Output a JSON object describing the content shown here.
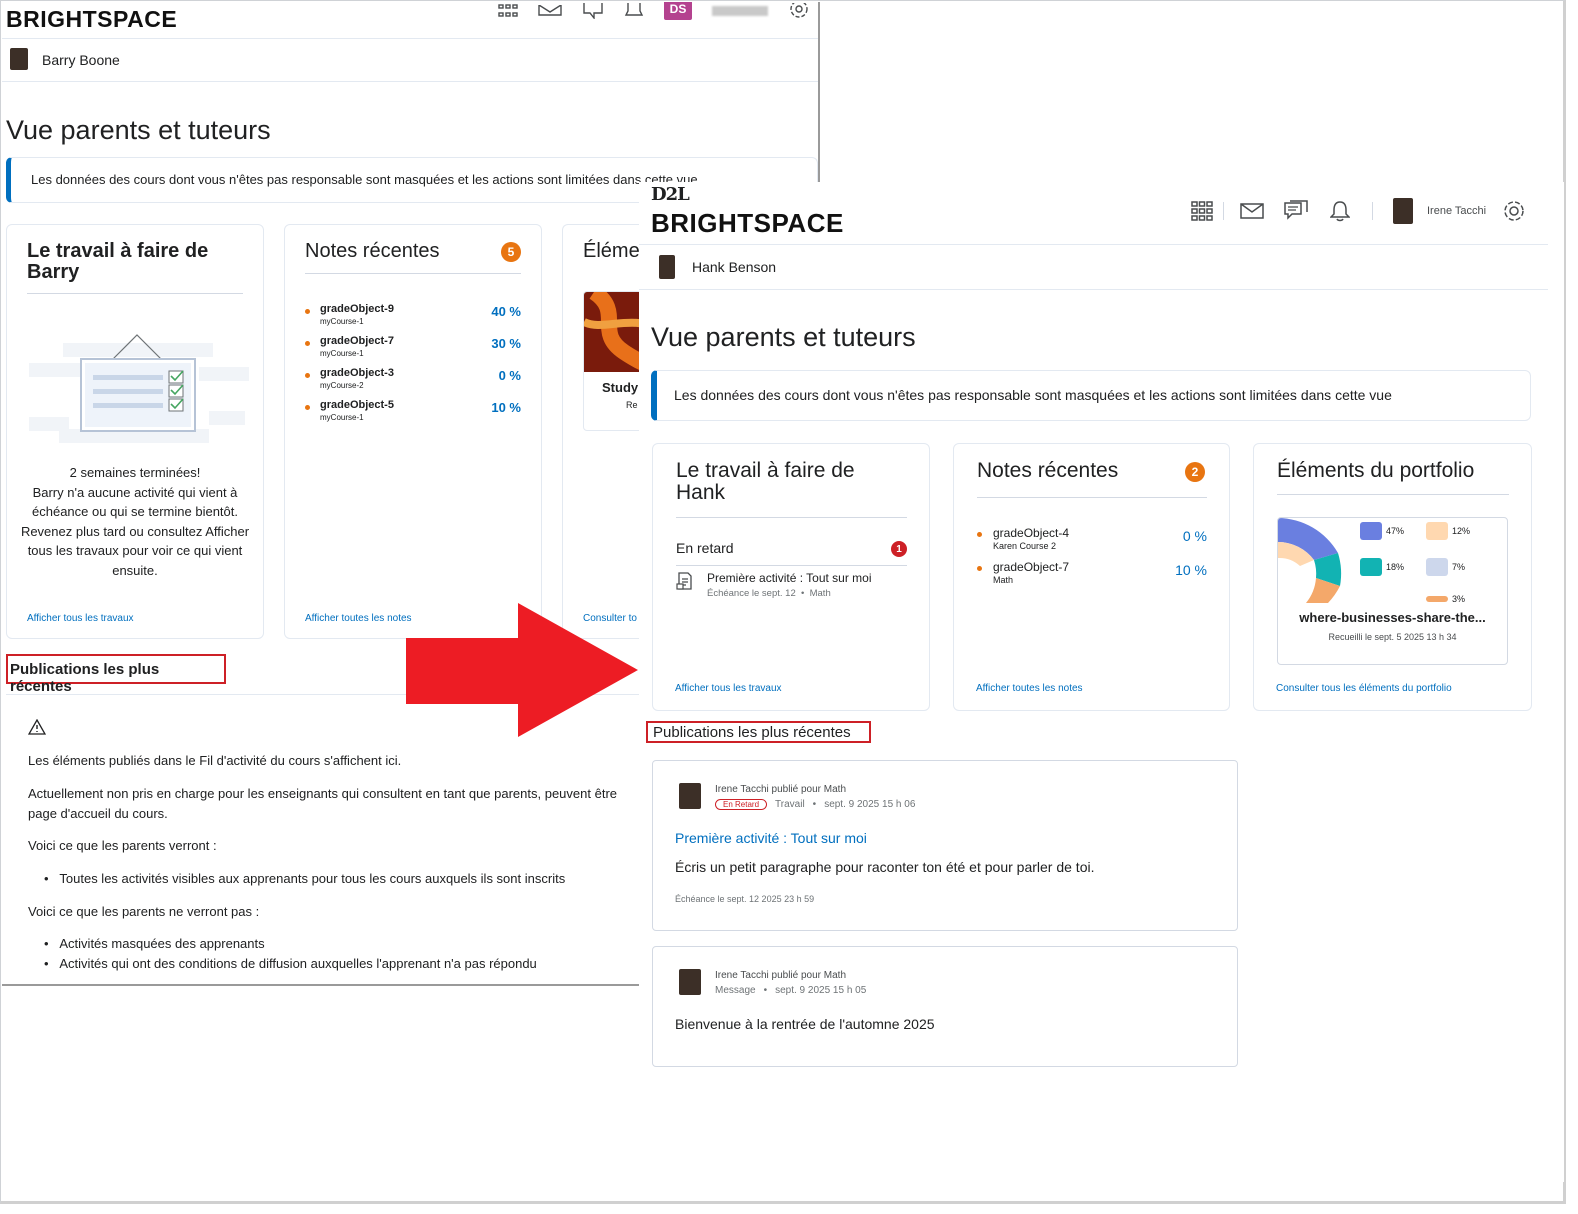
{
  "back": {
    "logo": "BRIGHTSPACE",
    "top_user_initials": "DS",
    "nav_user": "Barry Boone",
    "title": "Vue parents et tuteurs",
    "alert": "Les données des cours dont vous n'êtes pas responsable sont masquées et les actions sont limitées dans cette vue",
    "work_card": {
      "title_line1": "Le travail à faire de",
      "title_line2": "Barry",
      "empty_heading": "2 semaines terminées!",
      "empty_body": "Barry n'a aucune activité qui vient à échéance ou qui se termine bientôt. Revenez plus tard ou consultez Afficher tous les travaux pour voir ce qui vient ensuite.",
      "link": "Afficher tous les travaux"
    },
    "grades_card": {
      "title": "Notes récentes",
      "badge": "5",
      "items": [
        {
          "name": "gradeObject-9",
          "course": "myCourse-1",
          "value": "40 %"
        },
        {
          "name": "gradeObject-7",
          "course": "myCourse-1",
          "value": "30 %"
        },
        {
          "name": "gradeObject-3",
          "course": "myCourse-2",
          "value": "0 %"
        },
        {
          "name": "gradeObject-5",
          "course": "myCourse-1",
          "value": "10 %"
        }
      ],
      "link": "Afficher toutes les notes"
    },
    "portfolio_card": {
      "title": "Éléme",
      "item_title": "Study",
      "item_sub": "Re",
      "link": "Consulter to"
    },
    "publications": {
      "heading": "Publications les plus récentes",
      "p1": "Les éléments publiés dans le Fil d'activité du cours s'affichent ici.",
      "p2_line1": "Actuellement non pris en charge pour les enseignants qui consultent en tant que parents, peuvent être",
      "p2_line2": "page d'accueil du cours.",
      "p3": "Voici ce que les parents verront :",
      "li1": "Toutes les activités visibles aux apprenants pour tous les cours auxquels ils sont inscrits",
      "p4": "Voici ce que les parents ne verront pas :",
      "li2": "Activités masquées des apprenants",
      "li3": "Activités qui ont des conditions de diffusion auxquelles l'apprenant n'a pas répondu"
    }
  },
  "front": {
    "d2l": "D2L",
    "logo": "BRIGHTSPACE",
    "top_user": "Irene Tacchi",
    "nav_user": "Hank Benson",
    "title": "Vue parents et tuteurs",
    "alert": "Les données des cours dont vous n'êtes pas responsable sont masquées et les actions sont limitées dans cette vue",
    "work_card": {
      "title_line1": "Le travail à faire de",
      "title_line2": "Hank",
      "section": "En retard",
      "section_badge": "1",
      "activity_title": "Première activité : Tout sur moi",
      "activity_meta": "Échéance le sept. 12  •  Math",
      "link": "Afficher tous les travaux"
    },
    "grades_card": {
      "title": "Notes récentes",
      "badge": "2",
      "items": [
        {
          "name": "gradeObject-4",
          "course": "Karen Course 2",
          "value": "0 %"
        },
        {
          "name": "gradeObject-7",
          "course": "Math",
          "value": "10 %"
        }
      ],
      "link": "Afficher toutes les notes"
    },
    "portfolio_card": {
      "title": "Éléments du portfolio",
      "stats": [
        "47%",
        "12%",
        "18%",
        "7%",
        "3%"
      ],
      "caption": "where-businesses-share-the...",
      "date": "Recueilli le sept. 5 2025 13 h 34",
      "link": "Consulter tous les éléments du portfolio"
    },
    "publications": {
      "heading": "Publications les plus récentes",
      "post1": {
        "author": "Irene Tacchi publié pour Math",
        "late": "En Retard",
        "type": "Travail",
        "date": "sept. 9 2025 15 h 06",
        "title": "Première activité : Tout sur moi",
        "body": "Écris un petit paragraphe pour raconter ton été et pour parler de toi.",
        "due": "Échéance le sept. 12 2025 23 h 59"
      },
      "post2": {
        "author": "Irene Tacchi publié pour Math",
        "type": "Message",
        "date": "sept. 9 2025 15 h 05",
        "body": "Bienvenue à la rentrée de l'automne 2025"
      }
    }
  },
  "colors": {
    "accent": "#006fbf",
    "orange": "#e87511",
    "red": "#cd2026",
    "arrow": "#ed1c24"
  }
}
